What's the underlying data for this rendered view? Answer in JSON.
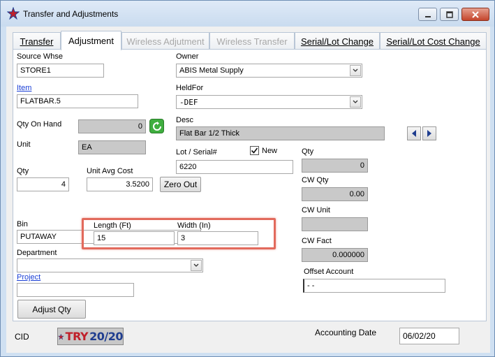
{
  "window": {
    "title": "Transfer and Adjustments"
  },
  "tabs": [
    {
      "label": "Transfer",
      "state": "normal"
    },
    {
      "label": "Adjustment",
      "state": "active"
    },
    {
      "label": "Wireless Adjutment",
      "state": "disabled"
    },
    {
      "label": "Wireless Transfer",
      "state": "disabled"
    },
    {
      "label": "Serial/Lot Change",
      "state": "normal"
    },
    {
      "label": "Serial/Lot Cost Change",
      "state": "normal"
    }
  ],
  "form": {
    "source_whse": {
      "label": "Source Whse",
      "value": "STORE1"
    },
    "item": {
      "label": "Item",
      "value": "FLATBAR.5"
    },
    "qty_on_hand": {
      "label": "Qty On Hand",
      "value": "0"
    },
    "unit": {
      "label": "Unit",
      "value": "EA"
    },
    "qty": {
      "label": "Qty",
      "value": "4"
    },
    "unit_avg_cost": {
      "label": "Unit Avg Cost",
      "value": "3.5200"
    },
    "zero_out": {
      "label": "Zero Out"
    },
    "length": {
      "label": "Length (Ft)",
      "value": "15"
    },
    "width": {
      "label": "Width (In)",
      "value": "3"
    },
    "bin": {
      "label": "Bin",
      "value": "PUTAWAY"
    },
    "department": {
      "label": "Department",
      "value": ""
    },
    "project": {
      "label": "Project",
      "value": ""
    },
    "adjust_qty": {
      "label": "Adjust Qty"
    },
    "owner": {
      "label": "Owner",
      "value": "ABIS Metal Supply"
    },
    "held_for": {
      "label": "HeldFor",
      "value": "-DEF"
    },
    "desc": {
      "label": "Desc",
      "value": "Flat Bar 1/2 Thick"
    },
    "lot_serial": {
      "label": "Lot / Serial#",
      "value": "6220"
    },
    "new": {
      "label": "New",
      "checked": true
    },
    "qty_right": {
      "label": "Qty",
      "value": "0"
    },
    "cw_qty": {
      "label": "CW Qty",
      "value": "0.00"
    },
    "cw_unit": {
      "label": "CW Unit",
      "value": ""
    },
    "cw_fact": {
      "label": "CW Fact",
      "value": "0.000000"
    },
    "offset_account": {
      "label": "Offset Account",
      "value": "-  -"
    }
  },
  "footer": {
    "cid_label": "CID",
    "logo_text_try": "TRY",
    "logo_text_year": "20/20",
    "accounting_date_label": "Accounting Date",
    "accounting_date": "06/02/20"
  },
  "colors": {
    "highlight": "#e26a5c",
    "link": "#1a3fd6",
    "readonly_bg": "#c9c9c9"
  },
  "icons": [
    "app-star-icon",
    "minimize-icon",
    "maximize-icon",
    "close-icon",
    "refresh-icon",
    "prev-arrow-icon",
    "next-arrow-icon",
    "chevron-down-icon",
    "check-icon"
  ]
}
